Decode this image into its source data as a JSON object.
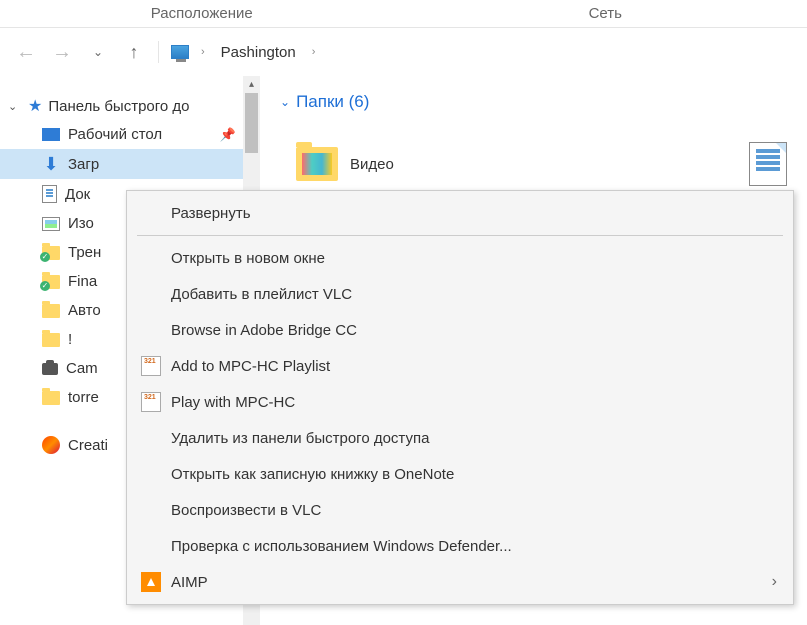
{
  "tabs": {
    "location": "Расположение",
    "network": "Сеть"
  },
  "breadcrumb": {
    "root": "Pashington"
  },
  "sidebar": {
    "root": "Панель быстрого до",
    "items": [
      {
        "label": "Рабочий стол"
      },
      {
        "label": "Загр"
      },
      {
        "label": "Док"
      },
      {
        "label": "Изо"
      },
      {
        "label": "Трен"
      },
      {
        "label": "Fina"
      },
      {
        "label": "Авто"
      },
      {
        "label": "!"
      },
      {
        "label": "Cam"
      },
      {
        "label": "torre"
      },
      {
        "label": "Creati"
      }
    ]
  },
  "content": {
    "section": "Папки (6)",
    "video": "Видео"
  },
  "ctx": {
    "expand": "Развернуть",
    "new_window": "Открыть в новом окне",
    "vlc_add": "Добавить в плейлист VLC",
    "bridge": "Browse in Adobe Bridge CC",
    "mpc_add": "Add to MPC-HC Playlist",
    "mpc_play": "Play with MPC-HC",
    "unpin": "Удалить из панели быстрого доступа",
    "onenote": "Открыть как записную книжку в OneNote",
    "vlc_play": "Воспроизвести в VLC",
    "defender": "Проверка с использованием Windows Defender...",
    "aimp": "AIMP"
  }
}
